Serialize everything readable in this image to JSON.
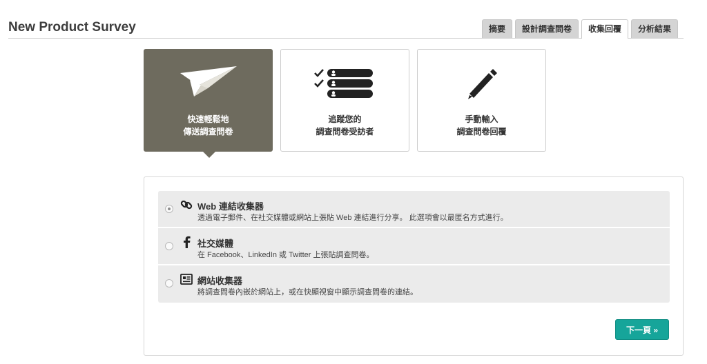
{
  "header": {
    "title": "New Product Survey",
    "tabs": [
      {
        "label": "摘要",
        "active": false
      },
      {
        "label": "設計調查問卷",
        "active": false
      },
      {
        "label": "收集回覆",
        "active": true
      },
      {
        "label": "分析結果",
        "active": false
      }
    ]
  },
  "cards": [
    {
      "line1": "快速輕鬆地",
      "line2": "傳送調查問卷",
      "icon": "paper-plane-icon",
      "active": true
    },
    {
      "line1": "追蹤您的",
      "line2": "調查問卷受訪者",
      "icon": "checklist-icon",
      "active": false
    },
    {
      "line1": "手動輸入",
      "line2": "調查問卷回覆",
      "icon": "pencil-icon",
      "active": false
    }
  ],
  "collectors": [
    {
      "title": "Web 連結收集器",
      "desc": "透過電子郵件、在社交媒體或網站上張貼 Web 連結進行分享。 此選項會以最匿名方式進行。",
      "icon": "link-icon",
      "selected": true
    },
    {
      "title": "社交媒體",
      "desc": "在 Facebook、LinkedIn 或 Twitter 上張貼調查問卷。",
      "icon": "facebook-icon",
      "selected": false
    },
    {
      "title": "網站收集器",
      "desc": "將調查問卷內嵌於網站上，或在快顯視窗中顯示調查問卷的連結。",
      "icon": "website-icon",
      "selected": false
    }
  ],
  "next_label": "下一頁 »",
  "colors": {
    "accent": "#16a59a",
    "active_card": "#6e6b5e"
  }
}
